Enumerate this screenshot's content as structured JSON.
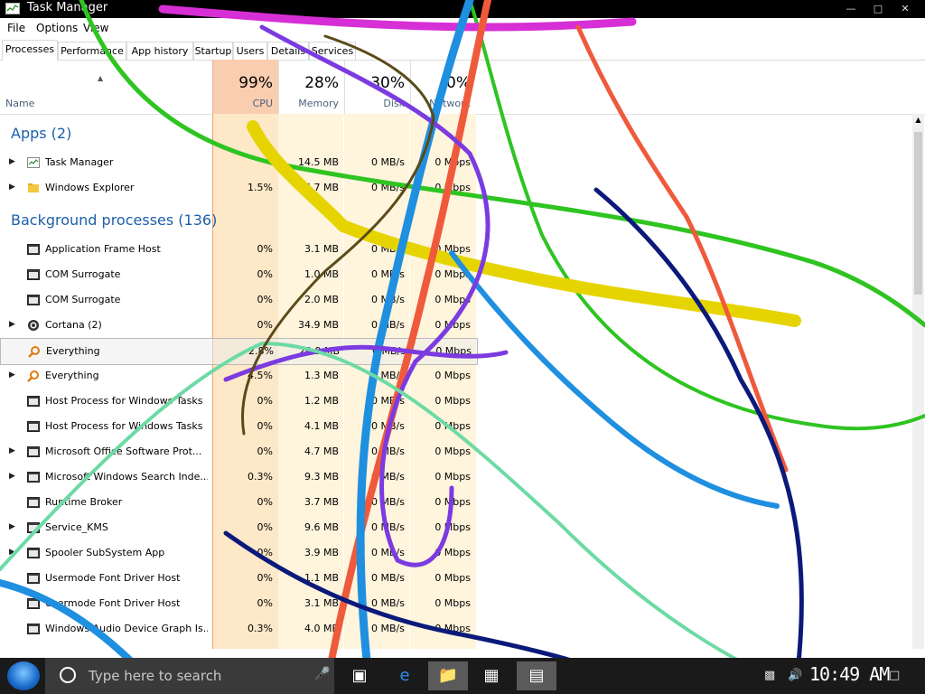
{
  "window": {
    "title": "Task Manager"
  },
  "menu": [
    "File",
    "Options",
    "View"
  ],
  "tabs": [
    "Processes",
    "Performance",
    "App history",
    "Startup",
    "Users",
    "Details",
    "Services"
  ],
  "header": {
    "name_label": "Name",
    "cpu_pct": "99%",
    "cpu_label": "CPU",
    "memory_pct": "28%",
    "memory_label": "Memory",
    "disk_pct": "30%",
    "disk_label": "Disk",
    "network_pct": "0%",
    "network_label": "Network"
  },
  "groups": {
    "apps": "Apps (2)",
    "background": "Background processes (136)"
  },
  "apps": [
    {
      "name": "Task Manager",
      "cpu": "",
      "memory": "14.5 MB",
      "disk": "0 MB/s",
      "network": "0 Mbps"
    },
    {
      "name": "Windows Explorer",
      "cpu": "1.5%",
      "memory": "36.7 MB",
      "disk": "0 MB/s",
      "network": "0 Mbps"
    }
  ],
  "background": [
    {
      "name": "Application Frame Host",
      "cpu": "0%",
      "memory": "3.1 MB",
      "disk": "0 MB/s",
      "network": "0 Mbps",
      "expandable": false
    },
    {
      "name": "COM Surrogate",
      "cpu": "0%",
      "memory": "1.0 MB",
      "disk": "0 MB/s",
      "network": "0 Mbps",
      "expandable": false
    },
    {
      "name": "COM Surrogate",
      "cpu": "0%",
      "memory": "2.0 MB",
      "disk": "0 MB/s",
      "network": "0 Mbps",
      "expandable": false
    },
    {
      "name": "Cortana (2)",
      "cpu": "0%",
      "memory": "34.9 MB",
      "disk": "0 MB/s",
      "network": "0 Mbps",
      "expandable": true
    },
    {
      "name": "Everything",
      "cpu": "2.8%",
      "memory": "20.9 MB",
      "disk": "0 MB/s",
      "network": "0 Mbps",
      "expandable": false
    },
    {
      "name": "Everything",
      "cpu": "4.5%",
      "memory": "1.3 MB",
      "disk": "0 MB/s",
      "network": "0 Mbps",
      "expandable": true
    },
    {
      "name": "Host Process for Windows Tasks",
      "cpu": "0%",
      "memory": "1.2 MB",
      "disk": "0 MB/s",
      "network": "0 Mbps",
      "expandable": false
    },
    {
      "name": "Host Process for Windows Tasks",
      "cpu": "0%",
      "memory": "4.1 MB",
      "disk": "0 MB/s",
      "network": "0 Mbps",
      "expandable": false
    },
    {
      "name": "Microsoft Office Software Prot...",
      "cpu": "0%",
      "memory": "4.7 MB",
      "disk": "0 MB/s",
      "network": "0 Mbps",
      "expandable": true
    },
    {
      "name": "Microsoft Windows Search Inde...",
      "cpu": "0.3%",
      "memory": "9.3 MB",
      "disk": "0 MB/s",
      "network": "0 Mbps",
      "expandable": true
    },
    {
      "name": "Runtime Broker",
      "cpu": "0%",
      "memory": "3.7 MB",
      "disk": "0 MB/s",
      "network": "0 Mbps",
      "expandable": false
    },
    {
      "name": "Service_KMS",
      "cpu": "0%",
      "memory": "9.6 MB",
      "disk": "0 MB/s",
      "network": "0 Mbps",
      "expandable": true
    },
    {
      "name": "Spooler SubSystem App",
      "cpu": "0%",
      "memory": "3.9 MB",
      "disk": "0 MB/s",
      "network": "0 Mbps",
      "expandable": true
    },
    {
      "name": "Usermode Font Driver Host",
      "cpu": "0%",
      "memory": "1.1 MB",
      "disk": "0 MB/s",
      "network": "0 Mbps",
      "expandable": false
    },
    {
      "name": "Usermode Font Driver Host",
      "cpu": "0%",
      "memory": "3.1 MB",
      "disk": "0 MB/s",
      "network": "0 Mbps",
      "expandable": false
    },
    {
      "name": "Windows Audio Device Graph Is...",
      "cpu": "0.3%",
      "memory": "4.0 MB",
      "disk": "0 MB/s",
      "network": "0 Mbps",
      "expandable": false
    }
  ],
  "taskbar": {
    "search_placeholder": "Type here to search",
    "clock": "10:49 AM"
  },
  "colors": {
    "cpu_header": "#f9cdb0",
    "cpu_column": "#fde8c8",
    "group_text": "#1d5fa8",
    "taskbar": "#1a1a1a"
  }
}
